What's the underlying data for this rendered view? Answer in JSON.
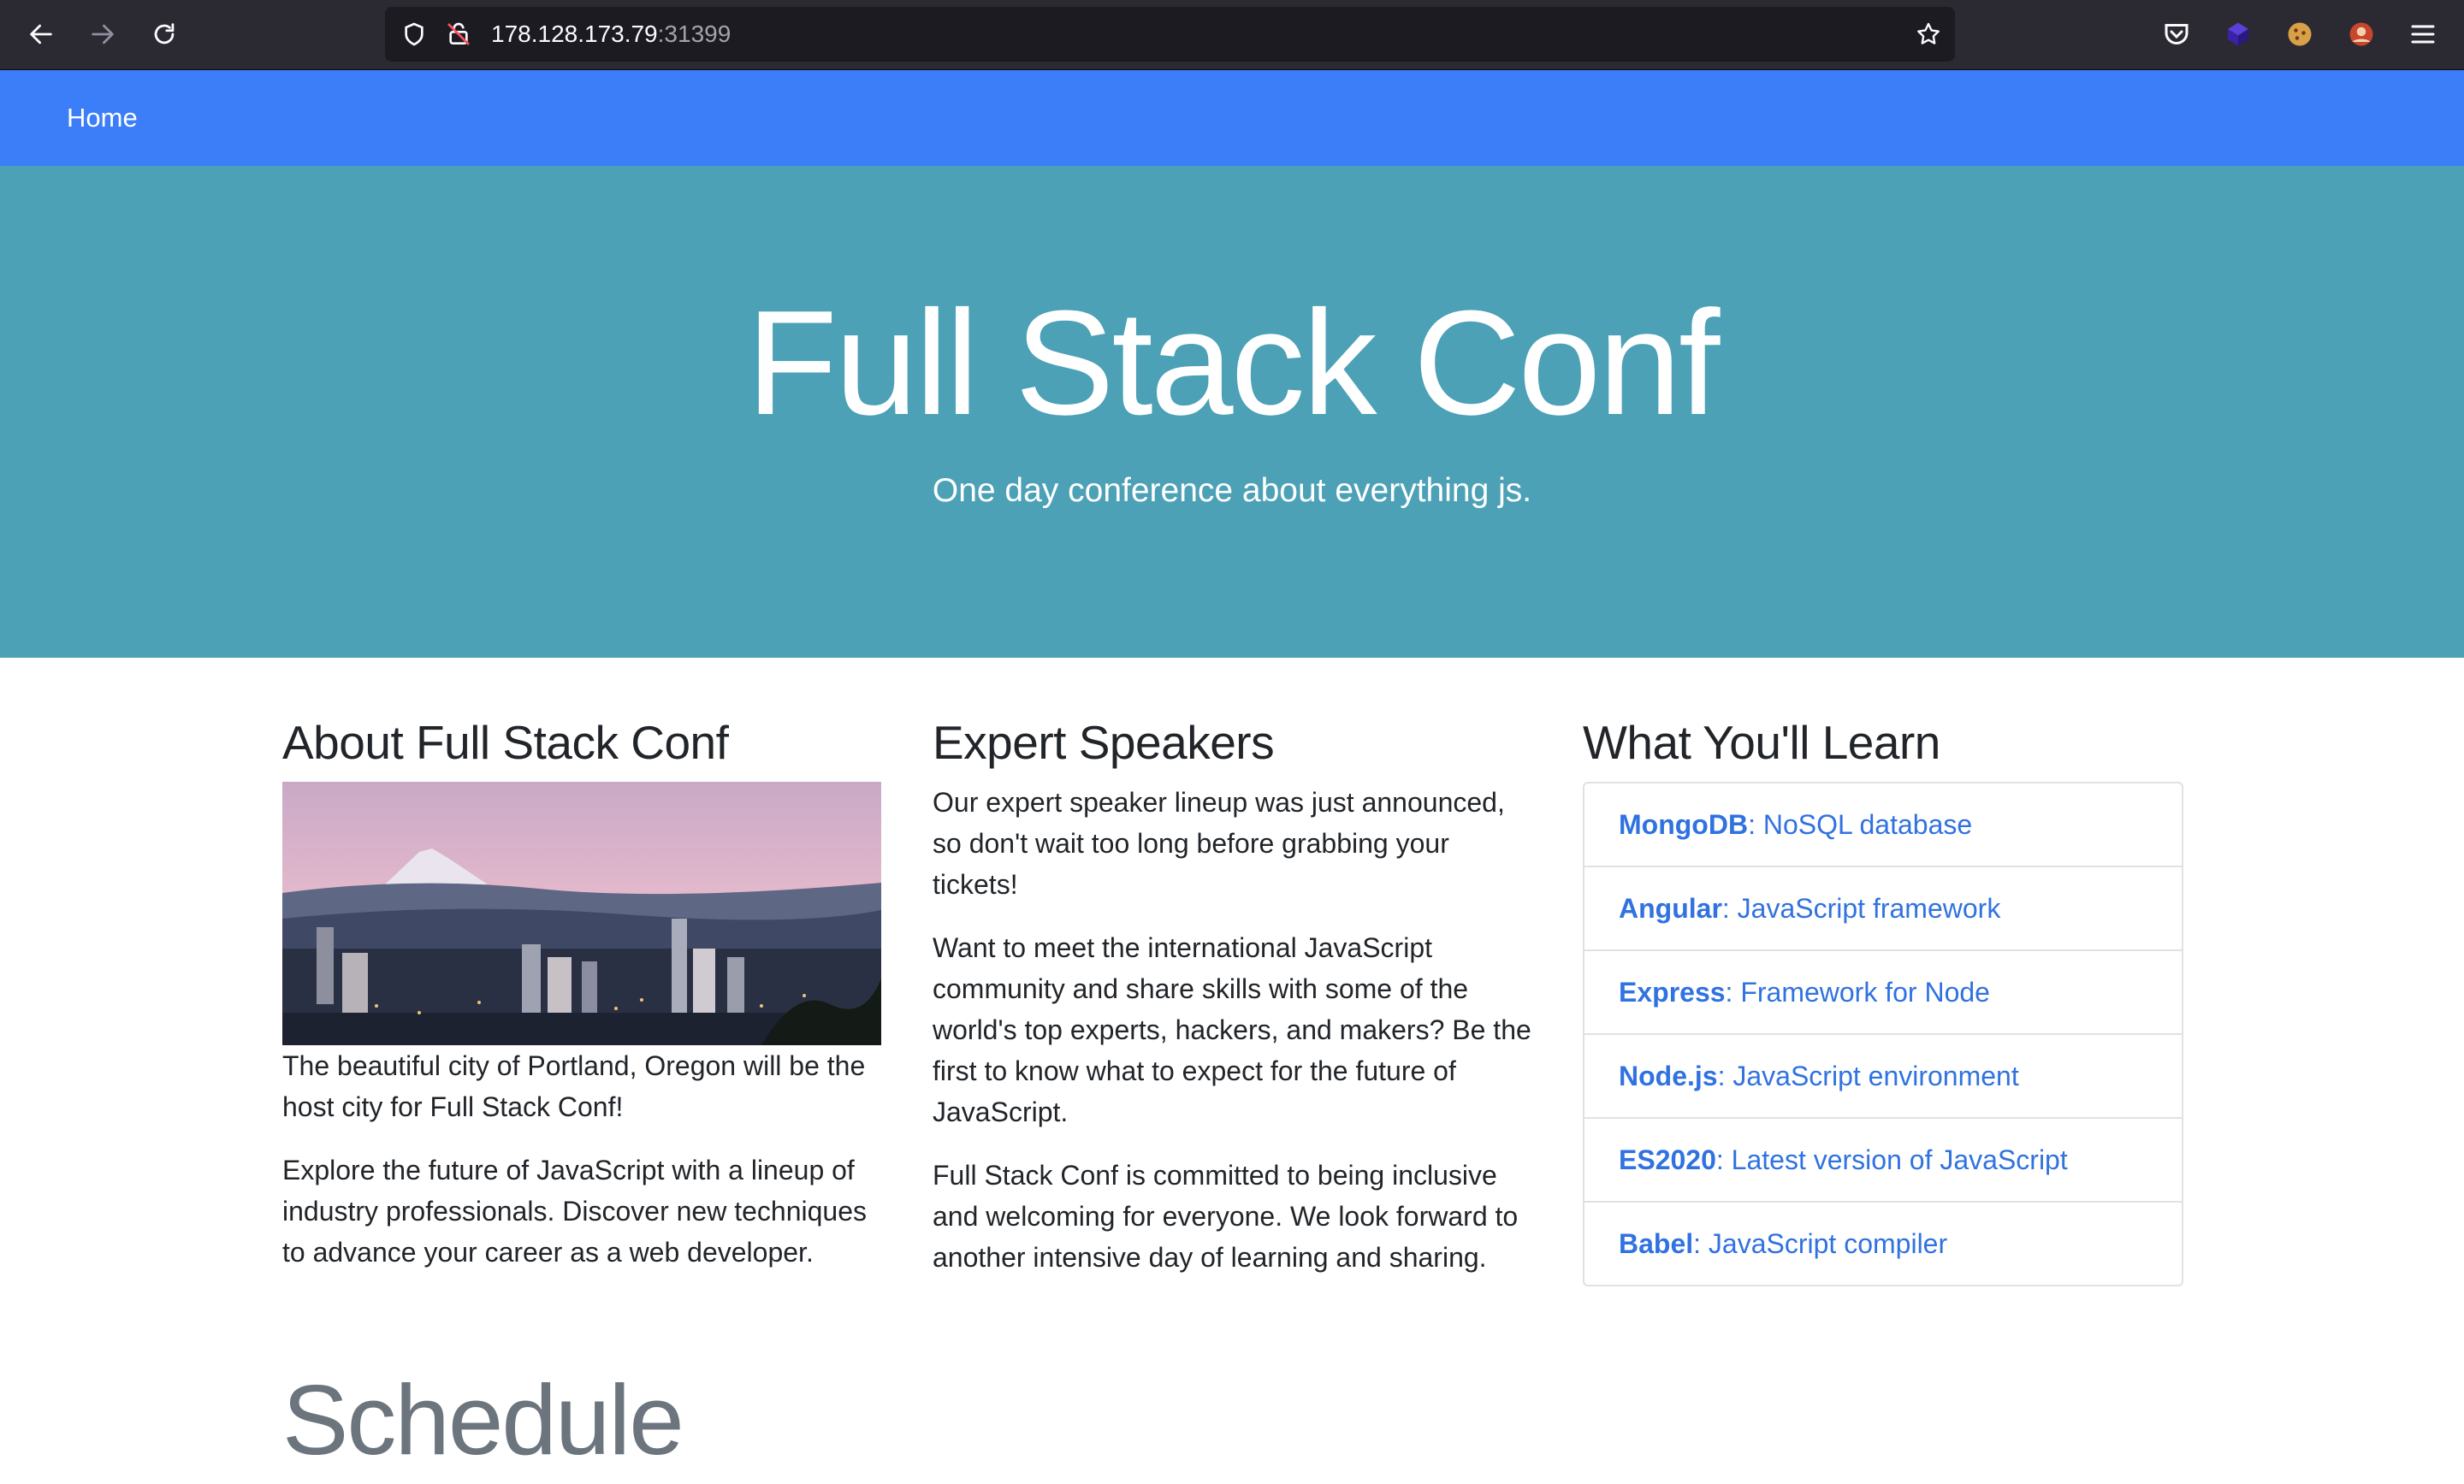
{
  "browser": {
    "url_host": "178.128.173.79",
    "url_port": ":31399"
  },
  "navbar": {
    "home_label": "Home"
  },
  "hero": {
    "title": "Full Stack Conf",
    "subtitle": "One day conference about everything js."
  },
  "about": {
    "heading": "About Full Stack Conf",
    "p1": "The beautiful city of Portland, Oregon will be the host city for Full Stack Conf!",
    "p2": "Explore the future of JavaScript with a lineup of industry professionals. Discover new techniques to advance your career as a web developer."
  },
  "speakers": {
    "heading": "Expert Speakers",
    "p1": "Our expert speaker lineup was just announced, so don't wait too long before grabbing your tickets!",
    "p2": "Want to meet the international JavaScript community and share skills with some of the world's top experts, hackers, and makers? Be the first to know what to expect for the future of JavaScript.",
    "p3": "Full Stack Conf is committed to being inclusive and welcoming for everyone. We look forward to another intensive day of learning and sharing."
  },
  "learn": {
    "heading": "What You'll Learn",
    "items": [
      {
        "name": "MongoDB",
        "desc": ": NoSQL database"
      },
      {
        "name": "Angular",
        "desc": ": JavaScript framework"
      },
      {
        "name": "Express",
        "desc": ": Framework for Node"
      },
      {
        "name": "Node.js",
        "desc": ": JavaScript environment"
      },
      {
        "name": "ES2020",
        "desc": ": Latest version of JavaScript"
      },
      {
        "name": "Babel",
        "desc": ": JavaScript compiler"
      }
    ]
  },
  "schedule": {
    "heading": "Schedule"
  },
  "colors": {
    "navbar": "#3b7ef7",
    "hero": "#4ca1b6",
    "link": "#3072e0"
  }
}
